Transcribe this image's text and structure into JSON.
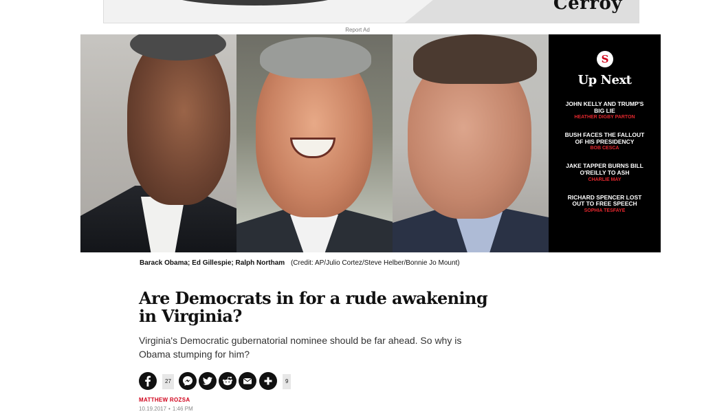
{
  "ad": {
    "logo": "Cerroy",
    "report_label": "Report Ad"
  },
  "hero": {
    "portraits": [
      "Barack Obama",
      "Ed Gillespie",
      "Ralph Northam"
    ]
  },
  "up_next": {
    "logo_letter": "S",
    "title": "Up Next",
    "stories": [
      {
        "headline": "JOHN KELLY AND TRUMP'S BIG LIE",
        "author": "HEATHER DIGBY PARTON"
      },
      {
        "headline": "BUSH FACES THE FALLOUT OF HIS PRESIDENCY",
        "author": "BOB CESCA"
      },
      {
        "headline": "JAKE TAPPER BURNS BILL O'REILLY TO ASH",
        "author": "CHARLIE MAY"
      },
      {
        "headline": "RICHARD SPENCER LOST OUT TO FREE SPEECH",
        "author": "SOPHIA TESFAYE"
      }
    ]
  },
  "caption": {
    "names": "Barack Obama; Ed Gillespie; Ralph Northam",
    "credit": "(Credit: AP/Julio Cortez/Steve Helber/Bonnie Jo Mount)"
  },
  "article": {
    "title": "Are Democrats in for a rude awakening in Virginia?",
    "dek": "Virginia's Democratic gubernatorial nominee should be far ahead. So why is Obama stumping for him?",
    "author": "MATTHEW ROZSA",
    "date": "10.19.2017",
    "separator": "•",
    "time": "1:46 PM"
  },
  "share": {
    "facebook_count": "27",
    "more_count": "9",
    "icons": [
      "facebook-icon",
      "messenger-icon",
      "twitter-icon",
      "reddit-icon",
      "email-icon",
      "plus-icon"
    ]
  },
  "colors": {
    "accent_red": "#d0021b",
    "up_next_bg": "#000000"
  }
}
